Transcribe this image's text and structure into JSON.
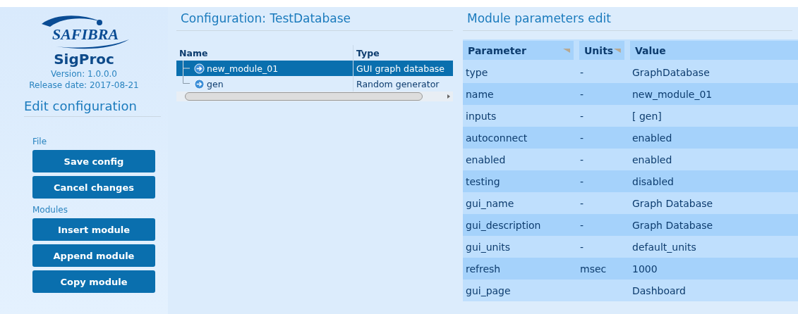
{
  "sidebar": {
    "logo_text": "SAFIBRA",
    "app_name": "SigProc",
    "version": "Version: 1.0.0.0",
    "release": "Release date: 2017-08-21",
    "heading": "Edit configuration",
    "groups": [
      {
        "label": "File",
        "buttons": [
          "Save config",
          "Cancel changes"
        ]
      },
      {
        "label": "Modules",
        "buttons": [
          "Insert module",
          "Append module",
          "Copy module"
        ]
      }
    ]
  },
  "configuration": {
    "title": "Configuration: TestDatabase",
    "columns": [
      "Name",
      "Type"
    ],
    "rows": [
      {
        "name": "new_module_01",
        "type": "GUI graph database",
        "selected": true
      },
      {
        "name": "gen",
        "type": "Random generator",
        "selected": false
      }
    ]
  },
  "parameters": {
    "title": "Module parameters edit",
    "columns": [
      "Parameter",
      "Units",
      "Value"
    ],
    "rows": [
      {
        "parameter": "type",
        "units": "-",
        "value": "GraphDatabase"
      },
      {
        "parameter": "name",
        "units": "-",
        "value": "new_module_01"
      },
      {
        "parameter": "inputs",
        "units": "-",
        "value": "[ gen]"
      },
      {
        "parameter": "autoconnect",
        "units": "-",
        "value": "enabled"
      },
      {
        "parameter": "enabled",
        "units": "-",
        "value": "enabled"
      },
      {
        "parameter": "testing",
        "units": "-",
        "value": "disabled"
      },
      {
        "parameter": "gui_name",
        "units": "-",
        "value": "Graph Database"
      },
      {
        "parameter": "gui_description",
        "units": "-",
        "value": "Graph Database"
      },
      {
        "parameter": "gui_units",
        "units": "-",
        "value": "default_units"
      },
      {
        "parameter": "refresh",
        "units": "msec",
        "value": "1000"
      },
      {
        "parameter": "gui_page",
        "value": "Dashboard"
      }
    ]
  }
}
